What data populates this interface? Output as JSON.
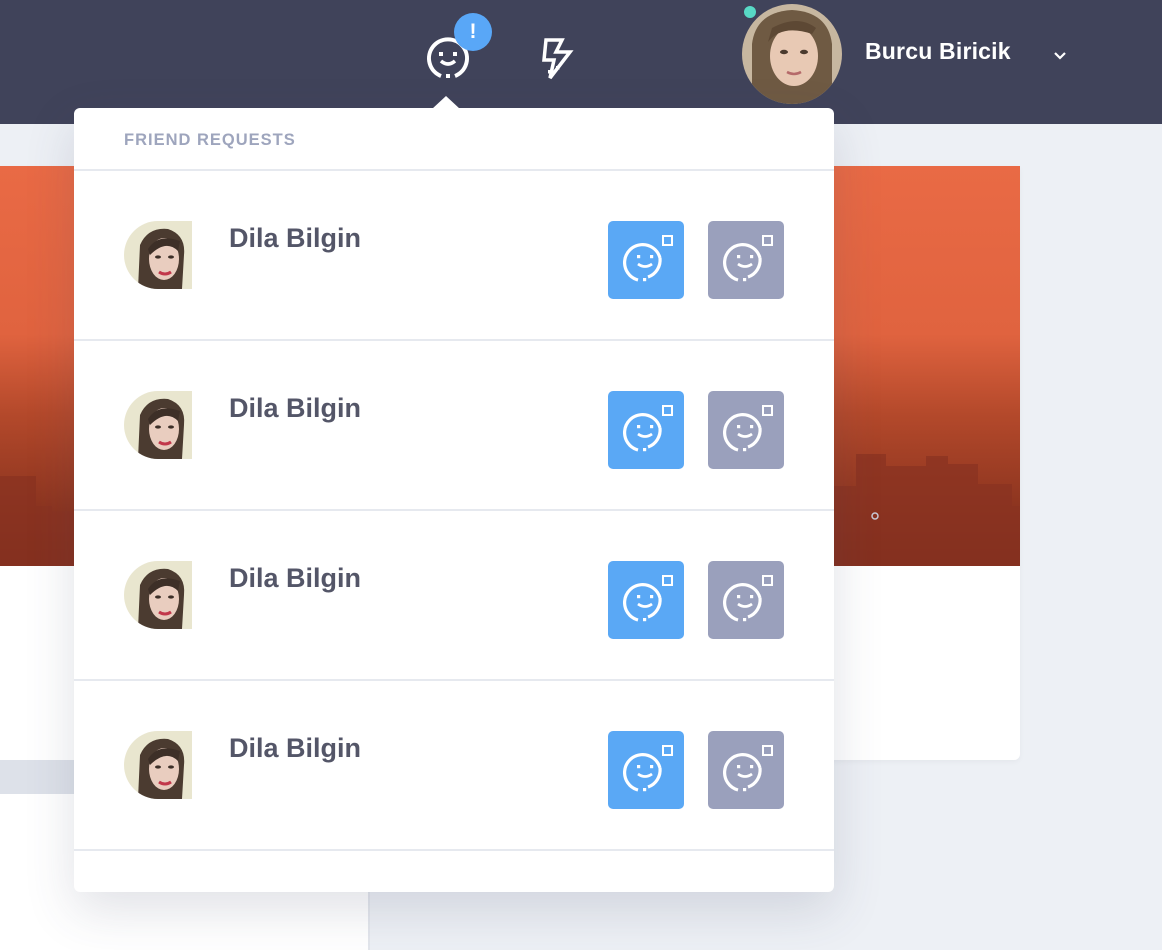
{
  "topbar": {
    "notification_badge": "!",
    "user_name": "Burcu Biricik",
    "icons": {
      "friends": "friend-requests-icon",
      "activity": "lightning-icon",
      "caret": "chevron-down-icon"
    },
    "colors": {
      "bar": "#40435a",
      "badge": "#59a7f7",
      "online": "#58d9c5"
    }
  },
  "dropdown": {
    "title": "FRIEND REQUESTS",
    "requests": [
      {
        "name": "Dila Bilgin"
      },
      {
        "name": "Dila Bilgin"
      },
      {
        "name": "Dila Bilgin"
      },
      {
        "name": "Dila Bilgin"
      }
    ],
    "accept_icon": "add-friend-icon",
    "decline_icon": "add-friend-icon",
    "colors": {
      "accept": "#5aa8f5",
      "decline": "#9aa0bc"
    }
  }
}
